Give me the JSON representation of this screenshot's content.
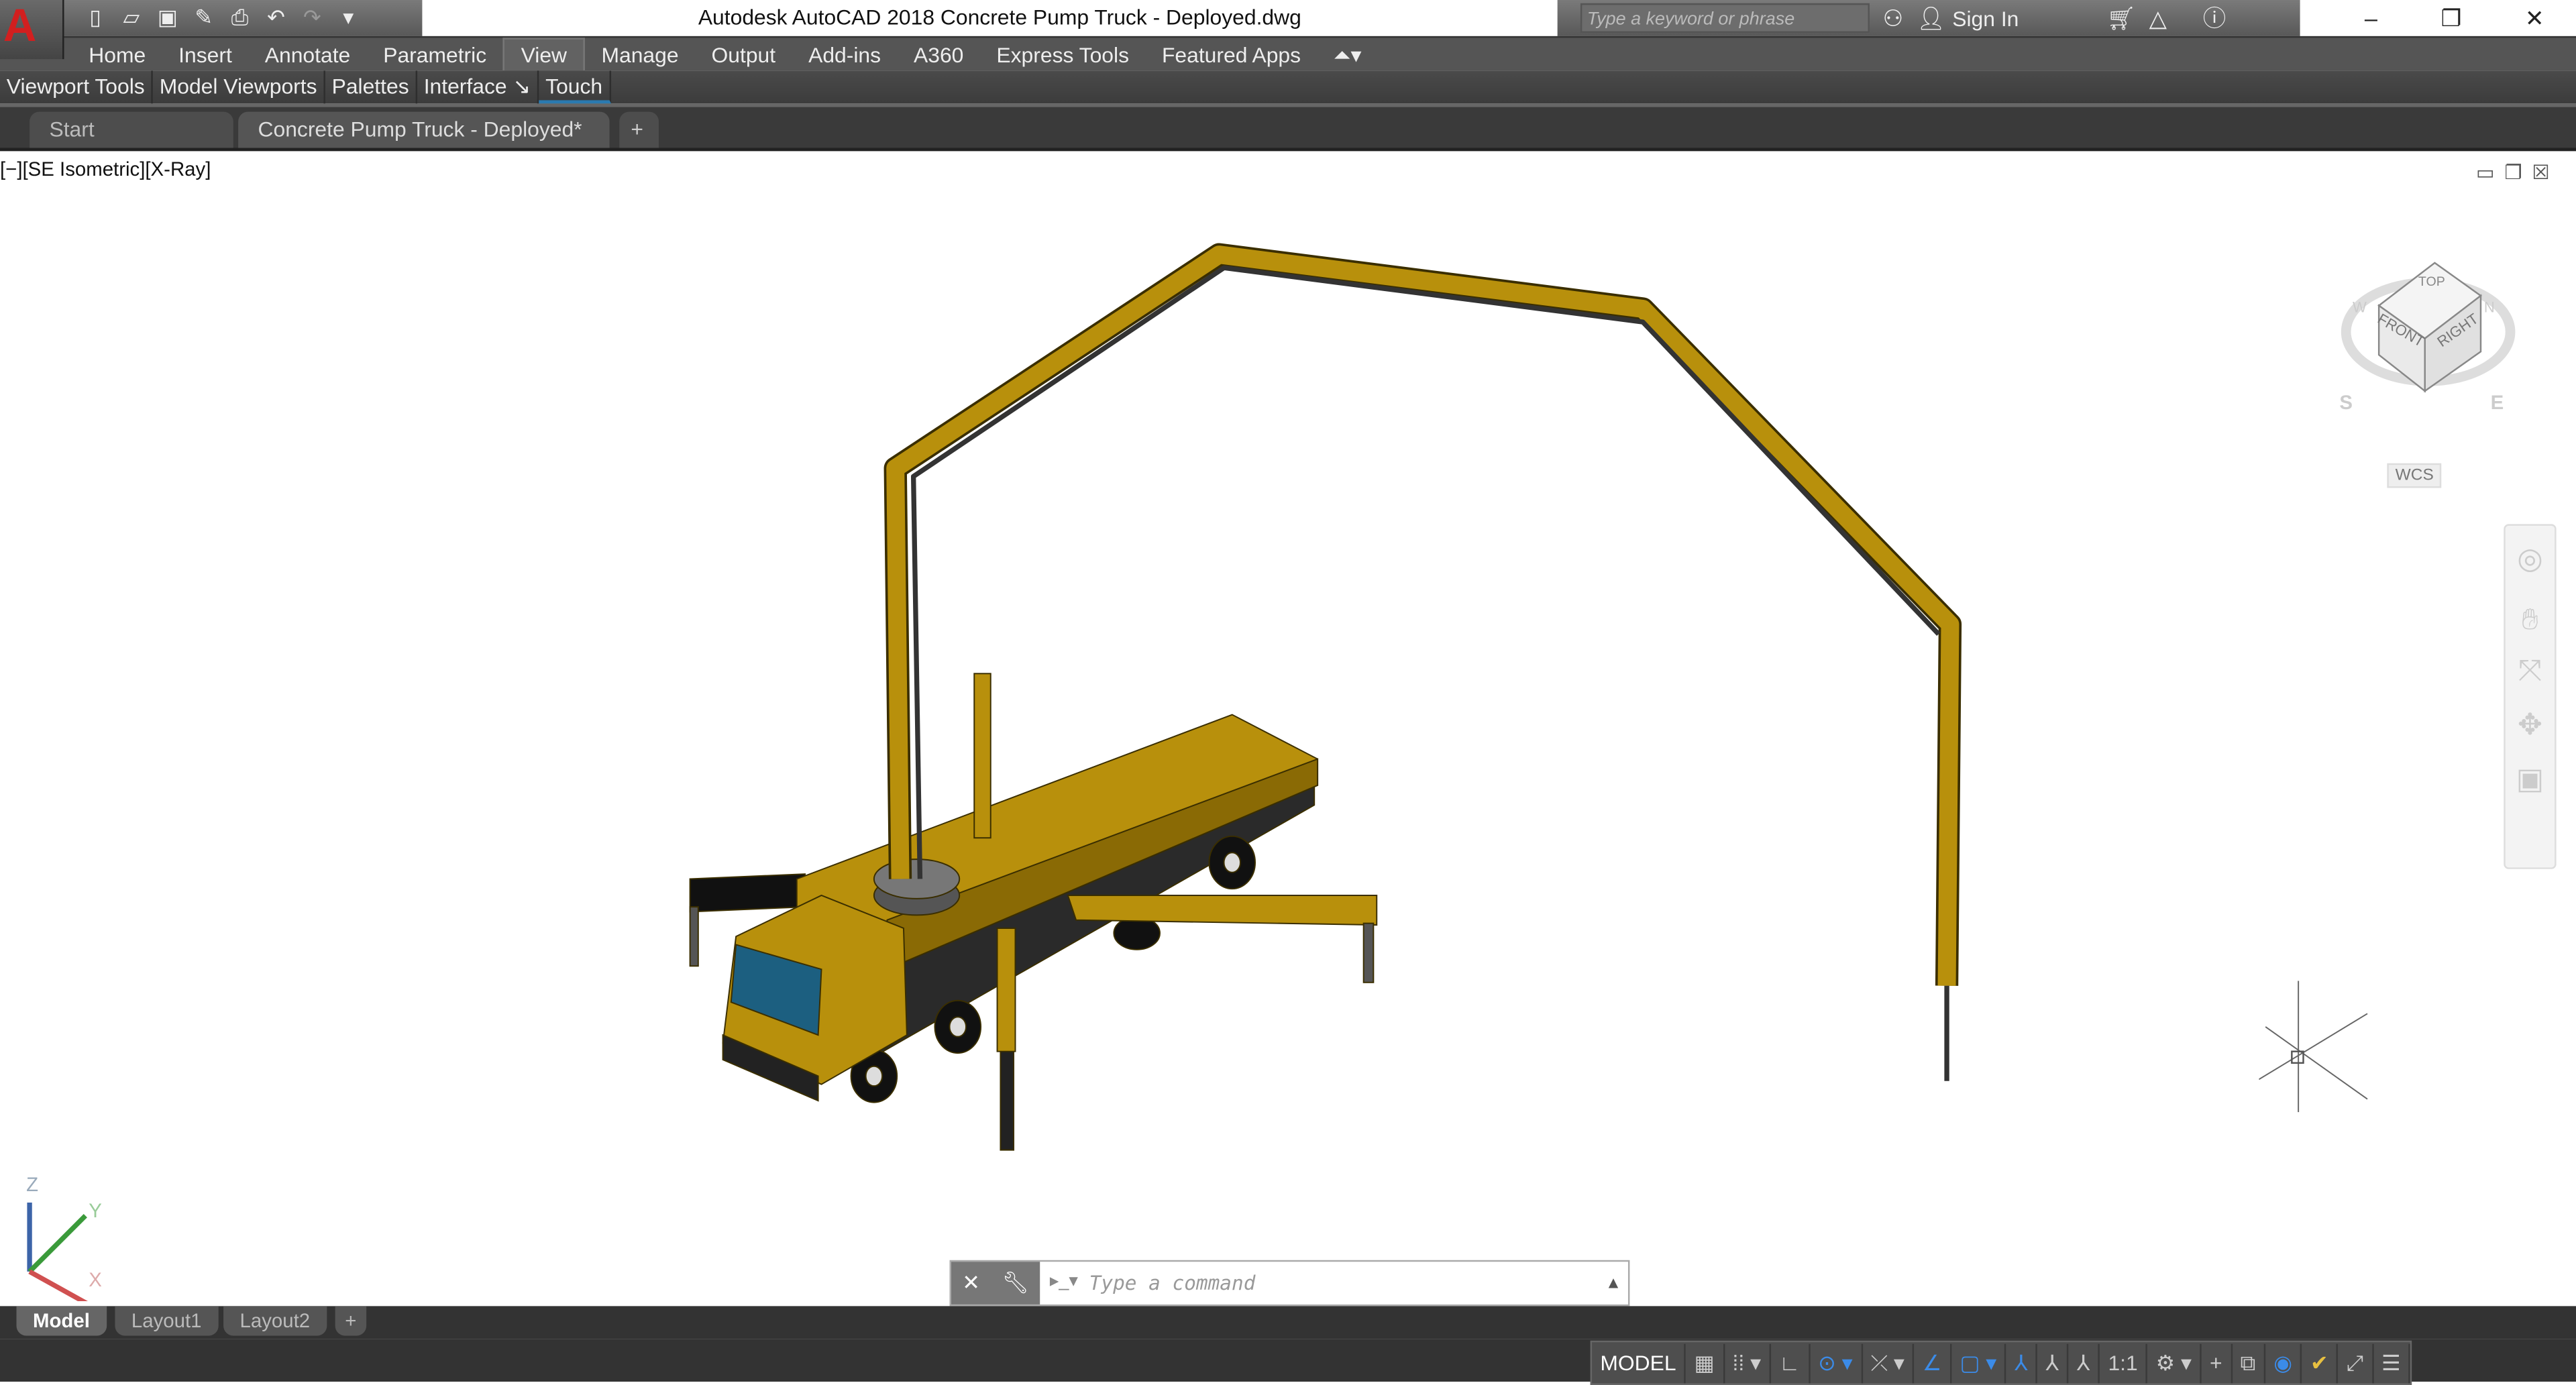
{
  "app": {
    "logo": "A",
    "title": "Autodesk AutoCAD 2018    Concrete Pump Truck - Deployed.dwg"
  },
  "qat": {
    "icons": [
      "new-icon",
      "open-icon",
      "save-icon",
      "save-as-icon",
      "plot-icon",
      "undo-icon",
      "redo-icon",
      "customize-icon"
    ]
  },
  "search": {
    "placeholder": "Type a keyword or phrase",
    "sign_in": "Sign In"
  },
  "ribbon": {
    "tabs": [
      "Home",
      "Insert",
      "Annotate",
      "Parametric",
      "View",
      "Manage",
      "Output",
      "Add-ins",
      "A360",
      "Express Tools",
      "Featured Apps"
    ],
    "active": "View",
    "panels": [
      "Viewport Tools",
      "Model Viewports",
      "Palettes",
      "Interface ↘",
      "Touch"
    ]
  },
  "file_tabs": {
    "start": "Start",
    "doc": "Concrete Pump Truck - Deployed*",
    "add": "+"
  },
  "viewport": {
    "label": "[−][SE Isometric][X-Ray]",
    "viewcube": {
      "top": "TOP",
      "front": "FRONT",
      "right": "RIGHT",
      "compass": [
        "S",
        "E",
        "W",
        "N"
      ],
      "wcs": "WCS"
    },
    "ucs": {
      "x": "X",
      "y": "Y",
      "z": "Z"
    },
    "model_color": "#b8900c"
  },
  "command": {
    "placeholder": "Type a command"
  },
  "layout_tabs": [
    "Model",
    "Layout1",
    "Layout2",
    "+"
  ],
  "status": {
    "model": "MODEL",
    "scale": "1:1",
    "accent": "#3b8be8"
  }
}
